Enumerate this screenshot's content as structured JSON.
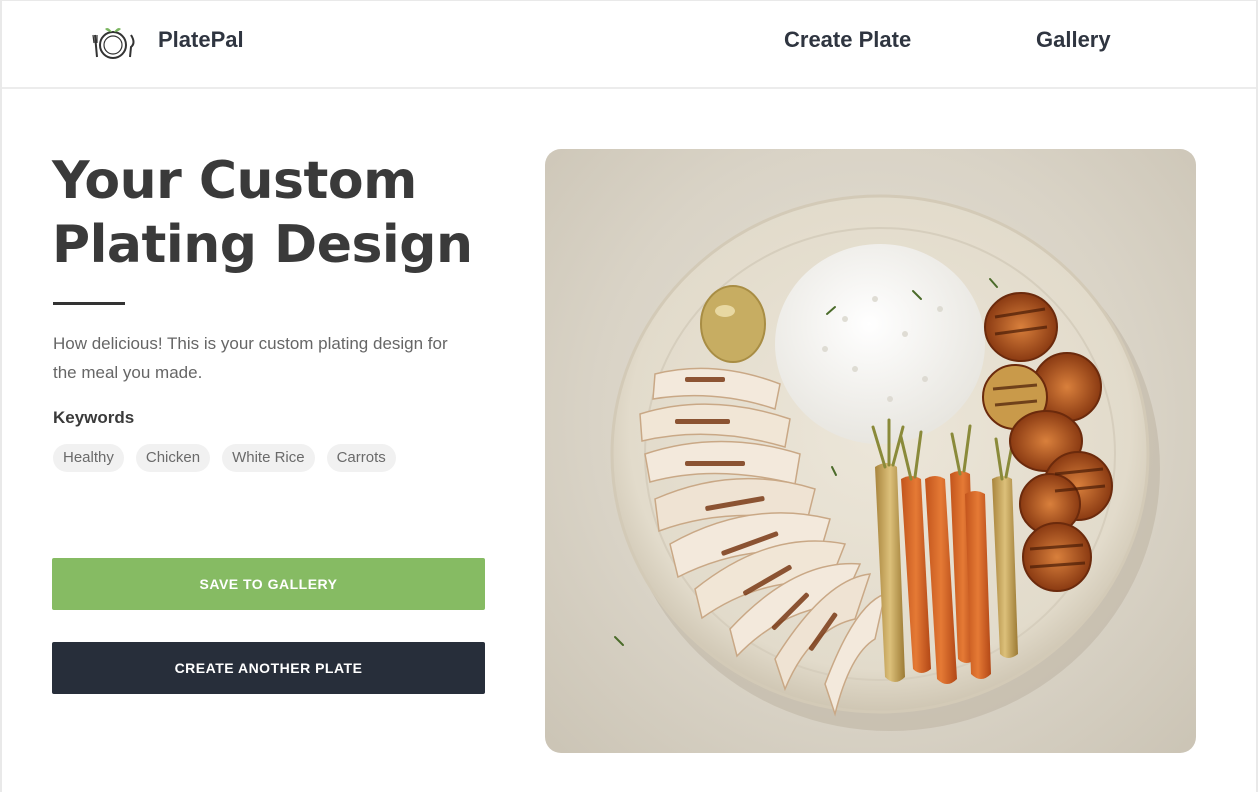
{
  "header": {
    "brand": "PlatePal",
    "logo_icon": "plate-with-fork-and-knife-icon",
    "nav": [
      {
        "label": "Create Plate"
      },
      {
        "label": "Gallery"
      }
    ]
  },
  "main": {
    "title": "Your Custom Plating Design",
    "description": "How delicious! This is your custom plating design for the meal you made.",
    "keywords_heading": "Keywords",
    "keywords": [
      "Healthy",
      "Chicken",
      "White Rice",
      "Carrots"
    ],
    "save_label": "SAVE TO GALLERY",
    "create_label": "CREATE ANOTHER PLATE"
  },
  "colors": {
    "brand_text": "#2f3540",
    "save_button": "#86bb63",
    "create_button": "#272e3a",
    "chip_bg": "#f1f1f1"
  }
}
